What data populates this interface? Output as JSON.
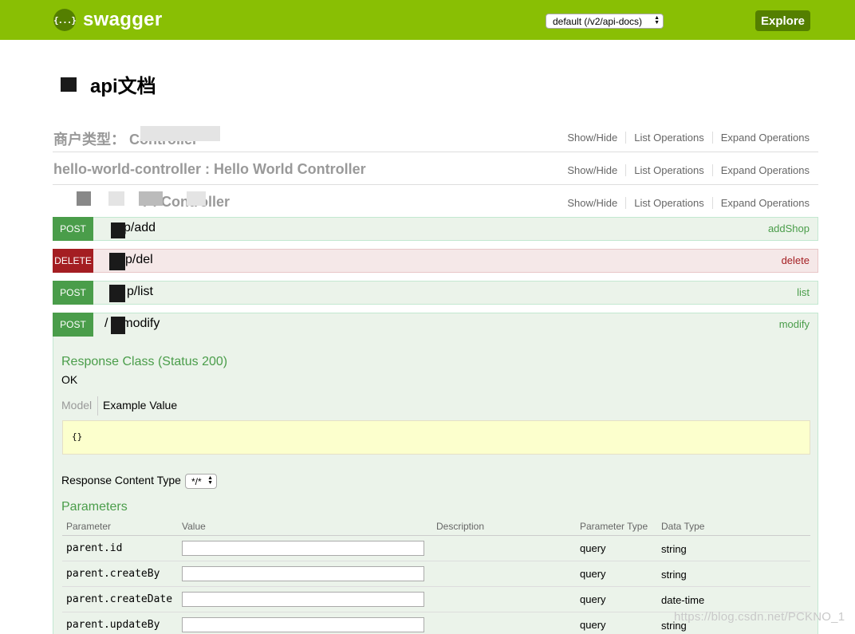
{
  "header": {
    "logo_mark": "{...}",
    "logo_text": "swagger",
    "spec_select_value": "default (/v2/api-docs)",
    "explore_label": "Explore",
    "brand_color": "#89bf04"
  },
  "page": {
    "title": "api文档"
  },
  "resources": [
    {
      "name": "商户类型：       Controller",
      "show_hide": "Show/Hide",
      "list_ops": "List Operations",
      "expand_ops": "Expand Operations"
    },
    {
      "name": "hello-world-controller : Hello World Controller",
      "show_hide": "Show/Hide",
      "list_ops": "List Operations",
      "expand_ops": "Expand Operations"
    },
    {
      "name": "r :        Controller",
      "show_hide": "Show/Hide",
      "list_ops": "List Operations",
      "expand_ops": "Expand Operations"
    }
  ],
  "operations": [
    {
      "method": "POST",
      "path": "p/add",
      "summary": "addShop"
    },
    {
      "method": "DELETE",
      "path": "p/del",
      "summary": "delete"
    },
    {
      "method": "POST",
      "path": "p/list",
      "summary": "list"
    },
    {
      "method": "POST",
      "path": "/     p/modify",
      "summary": "modify"
    }
  ],
  "expanded": {
    "response_class_title": "Response Class (Status 200)",
    "response_text": "OK",
    "model_tab": "Model",
    "example_tab": "Example Value",
    "example_value": "{}",
    "content_type_label": "Response Content Type",
    "content_type_value": "*/*",
    "parameters_title": "Parameters",
    "columns": [
      "Parameter",
      "Value",
      "Description",
      "Parameter Type",
      "Data Type"
    ],
    "params": [
      {
        "name": "parent.id",
        "param_type": "query",
        "data_type": "string"
      },
      {
        "name": "parent.createBy",
        "param_type": "query",
        "data_type": "string"
      },
      {
        "name": "parent.createDate",
        "param_type": "query",
        "data_type": "date-time"
      },
      {
        "name": "parent.updateBy",
        "param_type": "query",
        "data_type": "string"
      }
    ]
  },
  "watermark": "https://blog.csdn.net/PCKNO_1"
}
